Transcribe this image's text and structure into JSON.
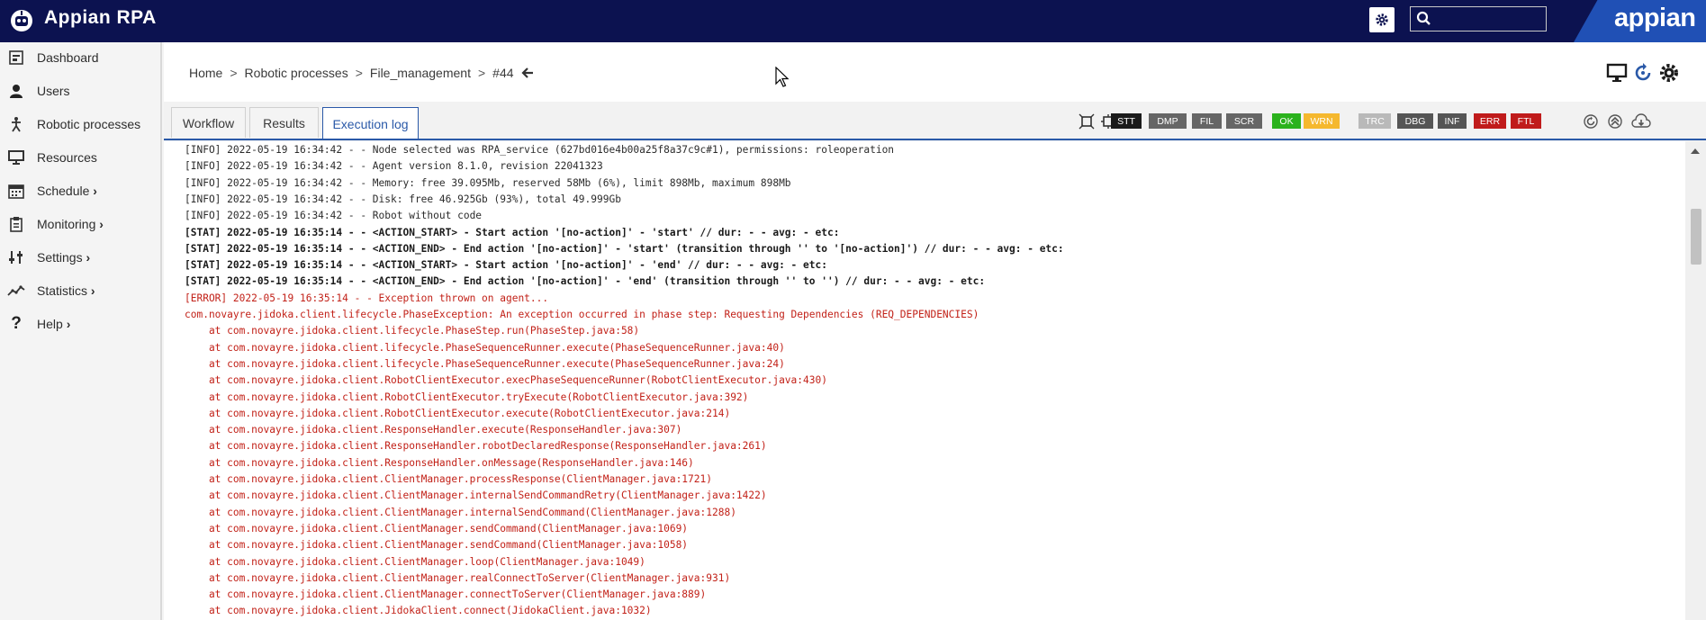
{
  "app": {
    "title": "Appian RPA",
    "brand": "appian",
    "colors": {
      "topbar": "#0c1250",
      "brand": "#2050b5",
      "accent": "#2a59a8",
      "error": "#c22118"
    }
  },
  "sidebar": {
    "items": [
      {
        "label": "Dashboard",
        "icon": "dashboard-icon",
        "chevron": ""
      },
      {
        "label": "Users",
        "icon": "user-icon",
        "chevron": ""
      },
      {
        "label": "Robotic processes",
        "icon": "robot-icon",
        "chevron": ""
      },
      {
        "label": "Resources",
        "icon": "monitor-icon",
        "chevron": ""
      },
      {
        "label": "Schedule",
        "icon": "calendar-icon",
        "chevron": "›"
      },
      {
        "label": "Monitoring",
        "icon": "clipboard-icon",
        "chevron": "›"
      },
      {
        "label": "Settings",
        "icon": "sliders-icon",
        "chevron": "›"
      },
      {
        "label": "Statistics",
        "icon": "chart-line-icon",
        "chevron": "›"
      },
      {
        "label": "Help",
        "icon": "question-icon",
        "chevron": "›"
      }
    ]
  },
  "breadcrumb": {
    "items": [
      "Home",
      "Robotic processes",
      "File_management",
      "#44"
    ],
    "separator": ">"
  },
  "tabs": [
    {
      "label": "Workflow",
      "active": false
    },
    {
      "label": "Results",
      "active": false
    },
    {
      "label": "Execution log",
      "active": true
    }
  ],
  "filters": [
    {
      "label": "STT",
      "bg": "#1b1b1b",
      "fg": "#ffffff"
    },
    {
      "label": "DMP",
      "bg": "#666666",
      "fg": "#ffffff"
    },
    {
      "label": "FIL",
      "bg": "#666666",
      "fg": "#ffffff"
    },
    {
      "label": "SCR",
      "bg": "#666666",
      "fg": "#ffffff"
    },
    {
      "label": "OK",
      "bg": "#2bb21d",
      "fg": "#ffffff"
    },
    {
      "label": "WRN",
      "bg": "#f5b82e",
      "fg": "#ffffff"
    },
    {
      "label": "TRC",
      "bg": "#b9b9b9",
      "fg": "#ffffff"
    },
    {
      "label": "DBG",
      "bg": "#555555",
      "fg": "#ffffff"
    },
    {
      "label": "INF",
      "bg": "#555555",
      "fg": "#ffffff"
    },
    {
      "label": "ERR",
      "bg": "#c01b1b",
      "fg": "#ffffff"
    },
    {
      "label": "FTL",
      "bg": "#c01b1b",
      "fg": "#ffffff"
    }
  ],
  "log": {
    "lines": [
      {
        "level": "info",
        "text": "[INFO] 2022-05-19 16:34:42 - - Node selected was RPA_service (627bd016e4b00a25f8a37c9c#1), permissions: roleoperation"
      },
      {
        "level": "info",
        "text": "[INFO] 2022-05-19 16:34:42 - - Agent version 8.1.0, revision 22041323"
      },
      {
        "level": "info",
        "text": "[INFO] 2022-05-19 16:34:42 - - Memory: free 39.095Mb, reserved 58Mb (6%), limit 898Mb, maximum 898Mb"
      },
      {
        "level": "info",
        "text": "[INFO] 2022-05-19 16:34:42 - - Disk: free 46.925Gb (93%), total 49.999Gb"
      },
      {
        "level": "info",
        "text": "[INFO] 2022-05-19 16:34:42 - - Robot without code"
      },
      {
        "level": "stat",
        "text": "[STAT] 2022-05-19 16:35:14 - - <ACTION_START> - Start action '[no-action]' - 'start' // dur: - - avg: - etc:"
      },
      {
        "level": "stat",
        "text": "[STAT] 2022-05-19 16:35:14 - - <ACTION_END> - End action '[no-action]' - 'start' (transition through '' to '[no-action]') // dur: - - avg: - etc:"
      },
      {
        "level": "stat",
        "text": "[STAT] 2022-05-19 16:35:14 - - <ACTION_START> - Start action '[no-action]' - 'end' // dur: - - avg: - etc:"
      },
      {
        "level": "stat",
        "text": "[STAT] 2022-05-19 16:35:14 - - <ACTION_END> - End action '[no-action]' - 'end' (transition through '' to '') // dur: - - avg: - etc:"
      },
      {
        "level": "error",
        "text": "[ERROR] 2022-05-19 16:35:14 - - Exception thrown on agent..."
      },
      {
        "level": "error",
        "text": "com.novayre.jidoka.client.lifecycle.PhaseException: An exception occurred in phase step: Requesting Dependencies (REQ_DEPENDENCIES)"
      },
      {
        "level": "error",
        "text": "    at com.novayre.jidoka.client.lifecycle.PhaseStep.run(PhaseStep.java:58)"
      },
      {
        "level": "error",
        "text": "    at com.novayre.jidoka.client.lifecycle.PhaseSequenceRunner.execute(PhaseSequenceRunner.java:40)"
      },
      {
        "level": "error",
        "text": "    at com.novayre.jidoka.client.lifecycle.PhaseSequenceRunner.execute(PhaseSequenceRunner.java:24)"
      },
      {
        "level": "error",
        "text": "    at com.novayre.jidoka.client.RobotClientExecutor.execPhaseSequenceRunner(RobotClientExecutor.java:430)"
      },
      {
        "level": "error",
        "text": "    at com.novayre.jidoka.client.RobotClientExecutor.tryExecute(RobotClientExecutor.java:392)"
      },
      {
        "level": "error",
        "text": "    at com.novayre.jidoka.client.RobotClientExecutor.execute(RobotClientExecutor.java:214)"
      },
      {
        "level": "error",
        "text": "    at com.novayre.jidoka.client.ResponseHandler.execute(ResponseHandler.java:307)"
      },
      {
        "level": "error",
        "text": "    at com.novayre.jidoka.client.ResponseHandler.robotDeclaredResponse(ResponseHandler.java:261)"
      },
      {
        "level": "error",
        "text": "    at com.novayre.jidoka.client.ResponseHandler.onMessage(ResponseHandler.java:146)"
      },
      {
        "level": "error",
        "text": "    at com.novayre.jidoka.client.ClientManager.processResponse(ClientManager.java:1721)"
      },
      {
        "level": "error",
        "text": "    at com.novayre.jidoka.client.ClientManager.internalSendCommandRetry(ClientManager.java:1422)"
      },
      {
        "level": "error",
        "text": "    at com.novayre.jidoka.client.ClientManager.internalSendCommand(ClientManager.java:1288)"
      },
      {
        "level": "error",
        "text": "    at com.novayre.jidoka.client.ClientManager.sendCommand(ClientManager.java:1069)"
      },
      {
        "level": "error",
        "text": "    at com.novayre.jidoka.client.ClientManager.sendCommand(ClientManager.java:1058)"
      },
      {
        "level": "error",
        "text": "    at com.novayre.jidoka.client.ClientManager.loop(ClientManager.java:1049)"
      },
      {
        "level": "error",
        "text": "    at com.novayre.jidoka.client.ClientManager.realConnectToServer(ClientManager.java:931)"
      },
      {
        "level": "error",
        "text": "    at com.novayre.jidoka.client.ClientManager.connectToServer(ClientManager.java:889)"
      },
      {
        "level": "error",
        "text": "    at com.novayre.jidoka.client.JidokaClient.connect(JidokaClient.java:1032)"
      }
    ]
  }
}
